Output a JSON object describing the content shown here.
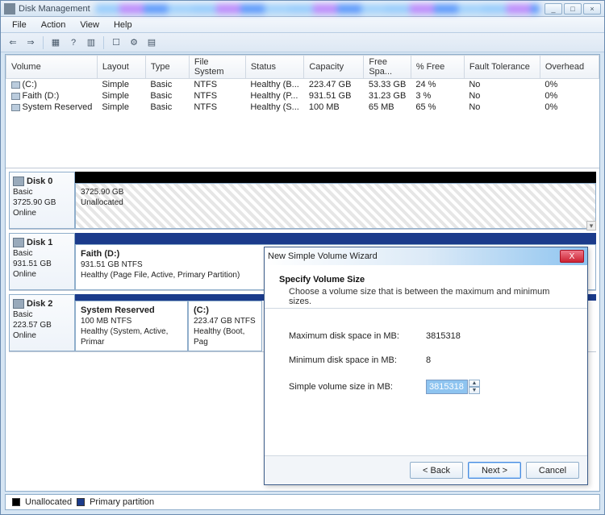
{
  "window": {
    "title": "Disk Management"
  },
  "winbuttons": {
    "min": "_",
    "max": "□",
    "close": "×"
  },
  "menu": {
    "file": "File",
    "action": "Action",
    "view": "View",
    "help": "Help"
  },
  "table": {
    "headers": {
      "volume": "Volume",
      "layout": "Layout",
      "type": "Type",
      "fs": "File System",
      "status": "Status",
      "capacity": "Capacity",
      "free": "Free Spa...",
      "pctfree": "% Free",
      "fault": "Fault Tolerance",
      "overhead": "Overhead"
    },
    "rows": [
      {
        "volume": "(C:)",
        "layout": "Simple",
        "type": "Basic",
        "fs": "NTFS",
        "status": "Healthy (B...",
        "capacity": "223.47 GB",
        "free": "53.33 GB",
        "pctfree": "24 %",
        "fault": "No",
        "overhead": "0%"
      },
      {
        "volume": "Faith (D:)",
        "layout": "Simple",
        "type": "Basic",
        "fs": "NTFS",
        "status": "Healthy (P...",
        "capacity": "931.51 GB",
        "free": "31.23 GB",
        "pctfree": "3 %",
        "fault": "No",
        "overhead": "0%"
      },
      {
        "volume": "System Reserved",
        "layout": "Simple",
        "type": "Basic",
        "fs": "NTFS",
        "status": "Healthy (S...",
        "capacity": "100 MB",
        "free": "65 MB",
        "pctfree": "65 %",
        "fault": "No",
        "overhead": "0%"
      }
    ]
  },
  "disks": {
    "d0": {
      "name": "Disk 0",
      "type": "Basic",
      "size": "3725.90 GB",
      "state": "Online",
      "p0_size": "3725.90 GB",
      "p0_label": "Unallocated"
    },
    "d1": {
      "name": "Disk 1",
      "type": "Basic",
      "size": "931.51 GB",
      "state": "Online",
      "p0_name": "Faith  (D:)",
      "p0_size": "931.51 GB NTFS",
      "p0_status": "Healthy (Page File, Active, Primary Partition)"
    },
    "d2": {
      "name": "Disk 2",
      "type": "Basic",
      "size": "223.57 GB",
      "state": "Online",
      "p0_name": "System Reserved",
      "p0_size": "100 MB NTFS",
      "p0_status": "Healthy (System, Active, Primar",
      "p1_name": "(C:)",
      "p1_size": "223.47 GB NTFS",
      "p1_status": "Healthy (Boot, Pag"
    }
  },
  "legend": {
    "unalloc": "Unallocated",
    "primary": "Primary partition"
  },
  "wizard": {
    "title": "New Simple Volume Wizard",
    "heading": "Specify Volume Size",
    "sub": "Choose a volume size that is between the maximum and minimum sizes.",
    "max_label": "Maximum disk space in MB:",
    "max_value": "3815318",
    "min_label": "Minimum disk space in MB:",
    "min_value": "8",
    "size_label": "Simple volume size in MB:",
    "size_value": "3815318",
    "back": "< Back",
    "next": "Next >",
    "cancel": "Cancel",
    "close": "X"
  }
}
